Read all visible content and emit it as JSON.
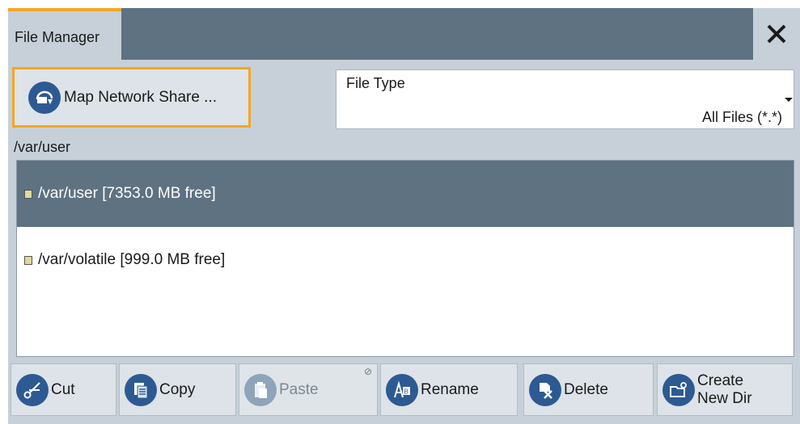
{
  "window": {
    "tab_title": "File Manager",
    "close_icon": "close-icon"
  },
  "map_network_share": {
    "label": "Map Network Share ...",
    "icon": "network-share-icon"
  },
  "file_type": {
    "label": "File Type",
    "value": "All Files (*.*)"
  },
  "current_path": "/var/user",
  "volumes": [
    {
      "label": "/var/user  [7353.0 MB free]",
      "selected": true
    },
    {
      "label": "/var/volatile  [999.0 MB free]",
      "selected": false
    }
  ],
  "toolbar": {
    "cut": "Cut",
    "copy": "Copy",
    "paste": "Paste",
    "rename": "Rename",
    "delete": "Delete",
    "create_line1": "Create",
    "create_line2": "New Dir"
  },
  "colors": {
    "accent": "#f5a623",
    "titlebar": "#5e7282",
    "panel": "#c7d0d8",
    "icon_blue": "#2d5a92",
    "selected_row": "#5e7282"
  }
}
